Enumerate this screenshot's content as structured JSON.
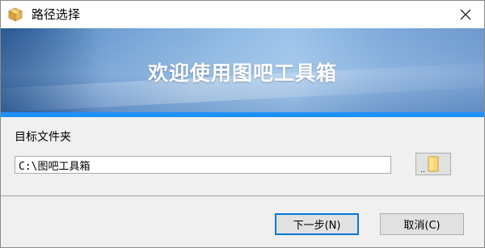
{
  "window": {
    "title": "路径选择",
    "icons": {
      "app": "package-box-icon",
      "close": "close-icon"
    }
  },
  "banner": {
    "title": "欢迎使用图吧工具箱",
    "colors": {
      "accent_line": "#1e90ff",
      "banner_light": "#9cc3ea",
      "banner_dark": "#3a6fa8"
    }
  },
  "form": {
    "label": "目标文件夹",
    "path_value": "C:\\图吧工具箱",
    "browse_icon": "folder-icon",
    "browse_dots": ".."
  },
  "buttons": {
    "next": "下一步(N)",
    "cancel": "取消(C)"
  }
}
